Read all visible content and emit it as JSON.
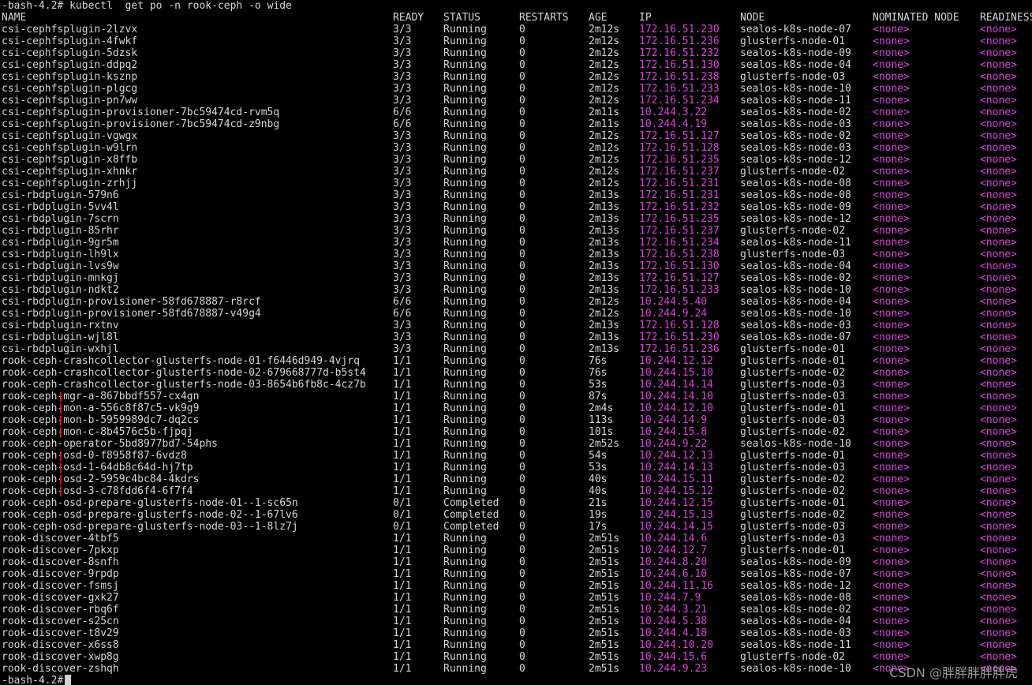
{
  "terminal": {
    "prompt": "-bash-4.2#",
    "command": "kubectl  get po -n rook-ceph -o wide",
    "end_prompt": "-bash-4.2#"
  },
  "table": {
    "headers": [
      "NAME",
      "READY",
      "STATUS",
      "RESTARTS",
      "AGE",
      "IP",
      "NODE",
      "NOMINATED NODE",
      "READINESS"
    ],
    "rows": [
      [
        "csi-cephfsplugin-2lzvx",
        "3/3",
        "Running",
        "0",
        "2m12s",
        "172.16.51.230",
        "sealos-k8s-node-07",
        "<none>",
        "<none>"
      ],
      [
        "csi-cephfsplugin-4fwkf",
        "3/3",
        "Running",
        "0",
        "2m12s",
        "172.16.51.236",
        "glusterfs-node-01",
        "<none>",
        "<none>"
      ],
      [
        "csi-cephfsplugin-5dzsk",
        "3/3",
        "Running",
        "0",
        "2m12s",
        "172.16.51.232",
        "sealos-k8s-node-09",
        "<none>",
        "<none>"
      ],
      [
        "csi-cephfsplugin-ddpq2",
        "3/3",
        "Running",
        "0",
        "2m12s",
        "172.16.51.130",
        "sealos-k8s-node-04",
        "<none>",
        "<none>"
      ],
      [
        "csi-cephfsplugin-ksznp",
        "3/3",
        "Running",
        "0",
        "2m12s",
        "172.16.51.238",
        "glusterfs-node-03",
        "<none>",
        "<none>"
      ],
      [
        "csi-cephfsplugin-plgcg",
        "3/3",
        "Running",
        "0",
        "2m12s",
        "172.16.51.233",
        "sealos-k8s-node-10",
        "<none>",
        "<none>"
      ],
      [
        "csi-cephfsplugin-pn7ww",
        "3/3",
        "Running",
        "0",
        "2m12s",
        "172.16.51.234",
        "sealos-k8s-node-11",
        "<none>",
        "<none>"
      ],
      [
        "csi-cephfsplugin-provisioner-7bc59474cd-rvm5q",
        "6/6",
        "Running",
        "0",
        "2m11s",
        "10.244.3.22",
        "sealos-k8s-node-02",
        "<none>",
        "<none>"
      ],
      [
        "csi-cephfsplugin-provisioner-7bc59474cd-z9nbg",
        "6/6",
        "Running",
        "0",
        "2m11s",
        "10.244.4.19",
        "sealos-k8s-node-03",
        "<none>",
        "<none>"
      ],
      [
        "csi-cephfsplugin-vgwgx",
        "3/3",
        "Running",
        "0",
        "2m12s",
        "172.16.51.127",
        "sealos-k8s-node-02",
        "<none>",
        "<none>"
      ],
      [
        "csi-cephfsplugin-w9lrn",
        "3/3",
        "Running",
        "0",
        "2m12s",
        "172.16.51.128",
        "sealos-k8s-node-03",
        "<none>",
        "<none>"
      ],
      [
        "csi-cephfsplugin-x8ffb",
        "3/3",
        "Running",
        "0",
        "2m12s",
        "172.16.51.235",
        "sealos-k8s-node-12",
        "<none>",
        "<none>"
      ],
      [
        "csi-cephfsplugin-xhnkr",
        "3/3",
        "Running",
        "0",
        "2m12s",
        "172.16.51.237",
        "glusterfs-node-02",
        "<none>",
        "<none>"
      ],
      [
        "csi-cephfsplugin-zrhjj",
        "3/3",
        "Running",
        "0",
        "2m12s",
        "172.16.51.231",
        "sealos-k8s-node-08",
        "<none>",
        "<none>"
      ],
      [
        "csi-rbdplugin-579n6",
        "3/3",
        "Running",
        "0",
        "2m13s",
        "172.16.51.231",
        "sealos-k8s-node-08",
        "<none>",
        "<none>"
      ],
      [
        "csi-rbdplugin-5vv4l",
        "3/3",
        "Running",
        "0",
        "2m13s",
        "172.16.51.232",
        "sealos-k8s-node-09",
        "<none>",
        "<none>"
      ],
      [
        "csi-rbdplugin-7scrn",
        "3/3",
        "Running",
        "0",
        "2m13s",
        "172.16.51.235",
        "sealos-k8s-node-12",
        "<none>",
        "<none>"
      ],
      [
        "csi-rbdplugin-85rhr",
        "3/3",
        "Running",
        "0",
        "2m13s",
        "172.16.51.237",
        "glusterfs-node-02",
        "<none>",
        "<none>"
      ],
      [
        "csi-rbdplugin-9gr5m",
        "3/3",
        "Running",
        "0",
        "2m13s",
        "172.16.51.234",
        "sealos-k8s-node-11",
        "<none>",
        "<none>"
      ],
      [
        "csi-rbdplugin-lh9lx",
        "3/3",
        "Running",
        "0",
        "2m13s",
        "172.16.51.238",
        "glusterfs-node-03",
        "<none>",
        "<none>"
      ],
      [
        "csi-rbdplugin-lvs9w",
        "3/3",
        "Running",
        "0",
        "2m13s",
        "172.16.51.130",
        "sealos-k8s-node-04",
        "<none>",
        "<none>"
      ],
      [
        "csi-rbdplugin-mnkgj",
        "3/3",
        "Running",
        "0",
        "2m13s",
        "172.16.51.127",
        "sealos-k8s-node-02",
        "<none>",
        "<none>"
      ],
      [
        "csi-rbdplugin-ndkt2",
        "3/3",
        "Running",
        "0",
        "2m13s",
        "172.16.51.233",
        "sealos-k8s-node-10",
        "<none>",
        "<none>"
      ],
      [
        "csi-rbdplugin-provisioner-58fd678887-r8rcf",
        "6/6",
        "Running",
        "0",
        "2m12s",
        "10.244.5.40",
        "sealos-k8s-node-04",
        "<none>",
        "<none>"
      ],
      [
        "csi-rbdplugin-provisioner-58fd678887-v49g4",
        "6/6",
        "Running",
        "0",
        "2m12s",
        "10.244.9.24",
        "sealos-k8s-node-10",
        "<none>",
        "<none>"
      ],
      [
        "csi-rbdplugin-rxtnv",
        "3/3",
        "Running",
        "0",
        "2m13s",
        "172.16.51.128",
        "sealos-k8s-node-03",
        "<none>",
        "<none>"
      ],
      [
        "csi-rbdplugin-wjl8l",
        "3/3",
        "Running",
        "0",
        "2m13s",
        "172.16.51.230",
        "sealos-k8s-node-07",
        "<none>",
        "<none>"
      ],
      [
        "csi-rbdplugin-wxhjl",
        "3/3",
        "Running",
        "0",
        "2m13s",
        "172.16.51.236",
        "glusterfs-node-01",
        "<none>",
        "<none>"
      ],
      [
        "rook-ceph-crashcollector-glusterfs-node-01-f6446d949-4vjrq",
        "1/1",
        "Running",
        "0",
        "76s",
        "10.244.12.12",
        "glusterfs-node-01",
        "<none>",
        "<none>"
      ],
      [
        "rook-ceph-crashcollector-glusterfs-node-02-679668777d-b5st4",
        "1/1",
        "Running",
        "0",
        "76s",
        "10.244.15.10",
        "glusterfs-node-02",
        "<none>",
        "<none>"
      ],
      [
        "rook-ceph-crashcollector-glusterfs-node-03-8654b6fb8c-4cz7b",
        "1/1",
        "Running",
        "0",
        "53s",
        "10.244.14.14",
        "glusterfs-node-03",
        "<none>",
        "<none>"
      ],
      [
        "rook-ceph-mgr-a-867bbdf557-cx4gn",
        "1/1",
        "Running",
        "0",
        "87s",
        "10.244.14.10",
        "glusterfs-node-03",
        "<none>",
        "<none>"
      ],
      [
        "rook-ceph-mon-a-556c8f87c5-vk9g9",
        "1/1",
        "Running",
        "0",
        "2m4s",
        "10.244.12.10",
        "glusterfs-node-01",
        "<none>",
        "<none>"
      ],
      [
        "rook-ceph-mon-b-5959989dc7-dq2cs",
        "1/1",
        "Running",
        "0",
        "113s",
        "10.244.14.9",
        "glusterfs-node-03",
        "<none>",
        "<none>"
      ],
      [
        "rook-ceph-mon-c-8b4576c5b-fjpqj",
        "1/1",
        "Running",
        "0",
        "101s",
        "10.244.15.8",
        "glusterfs-node-02",
        "<none>",
        "<none>"
      ],
      [
        "rook-ceph-operator-5bd8977bd7-54phs",
        "1/1",
        "Running",
        "0",
        "2m52s",
        "10.244.9.22",
        "sealos-k8s-node-10",
        "<none>",
        "<none>"
      ],
      [
        "rook-ceph-osd-0-f8958f87-6vdz8",
        "1/1",
        "Running",
        "0",
        "54s",
        "10.244.12.13",
        "glusterfs-node-01",
        "<none>",
        "<none>"
      ],
      [
        "rook-ceph-osd-1-64db8c64d-hj7tp",
        "1/1",
        "Running",
        "0",
        "53s",
        "10.244.14.13",
        "glusterfs-node-03",
        "<none>",
        "<none>"
      ],
      [
        "rook-ceph-osd-2-5959c4bc84-4kdrs",
        "1/1",
        "Running",
        "0",
        "40s",
        "10.244.15.11",
        "glusterfs-node-02",
        "<none>",
        "<none>"
      ],
      [
        "rook-ceph-osd-3-c78fdd6f4-6f7f4",
        "1/1",
        "Running",
        "0",
        "40s",
        "10.244.15.12",
        "glusterfs-node-02",
        "<none>",
        "<none>"
      ],
      [
        "rook-ceph-osd-prepare-glusterfs-node-01--1-sc65n",
        "0/1",
        "Completed",
        "0",
        "21s",
        "10.244.12.15",
        "glusterfs-node-01",
        "<none>",
        "<none>"
      ],
      [
        "rook-ceph-osd-prepare-glusterfs-node-02--1-67lv6",
        "0/1",
        "Completed",
        "0",
        "19s",
        "10.244.15.13",
        "glusterfs-node-02",
        "<none>",
        "<none>"
      ],
      [
        "rook-ceph-osd-prepare-glusterfs-node-03--1-8lz7j",
        "0/1",
        "Completed",
        "0",
        "17s",
        "10.244.14.15",
        "glusterfs-node-03",
        "<none>",
        "<none>"
      ],
      [
        "rook-discover-4tbf5",
        "1/1",
        "Running",
        "0",
        "2m51s",
        "10.244.14.6",
        "glusterfs-node-03",
        "<none>",
        "<none>"
      ],
      [
        "rook-discover-7pkxp",
        "1/1",
        "Running",
        "0",
        "2m51s",
        "10.244.12.7",
        "glusterfs-node-01",
        "<none>",
        "<none>"
      ],
      [
        "rook-discover-8snfh",
        "1/1",
        "Running",
        "0",
        "2m51s",
        "10.244.8.20",
        "sealos-k8s-node-09",
        "<none>",
        "<none>"
      ],
      [
        "rook-discover-9rpdp",
        "1/1",
        "Running",
        "0",
        "2m51s",
        "10.244.6.10",
        "sealos-k8s-node-07",
        "<none>",
        "<none>"
      ],
      [
        "rook-discover-fsmsj",
        "1/1",
        "Running",
        "0",
        "2m51s",
        "10.244.11.16",
        "sealos-k8s-node-12",
        "<none>",
        "<none>"
      ],
      [
        "rook-discover-gxk27",
        "1/1",
        "Running",
        "0",
        "2m51s",
        "10.244.7.9",
        "sealos-k8s-node-08",
        "<none>",
        "<none>"
      ],
      [
        "rook-discover-rbq6f",
        "1/1",
        "Running",
        "0",
        "2m51s",
        "10.244.3.21",
        "sealos-k8s-node-02",
        "<none>",
        "<none>"
      ],
      [
        "rook-discover-s25cn",
        "1/1",
        "Running",
        "0",
        "2m51s",
        "10.244.5.38",
        "sealos-k8s-node-04",
        "<none>",
        "<none>"
      ],
      [
        "rook-discover-t8v29",
        "1/1",
        "Running",
        "0",
        "2m51s",
        "10.244.4.18",
        "sealos-k8s-node-03",
        "<none>",
        "<none>"
      ],
      [
        "rook-discover-x6ss8",
        "1/1",
        "Running",
        "0",
        "2m51s",
        "10.244.10.20",
        "sealos-k8s-node-11",
        "<none>",
        "<none>"
      ],
      [
        "rook-discover-xwp8g",
        "1/1",
        "Running",
        "0",
        "2m51s",
        "10.244.15.6",
        "glusterfs-node-02",
        "<none>",
        "<none>"
      ],
      [
        "rook-discover-zshqh",
        "1/1",
        "Running",
        "0",
        "2m51s",
        "10.244.9.23",
        "sealos-k8s-node-10",
        "<none>",
        "<none>"
      ]
    ]
  },
  "colors": {
    "background": "#000000",
    "text": "#d6d6d6",
    "ip": "#e040e0",
    "none": "#e040e0",
    "annotation_mark": "#e01010"
  },
  "watermark": "CSDN @胖胖胖胖胖虎"
}
